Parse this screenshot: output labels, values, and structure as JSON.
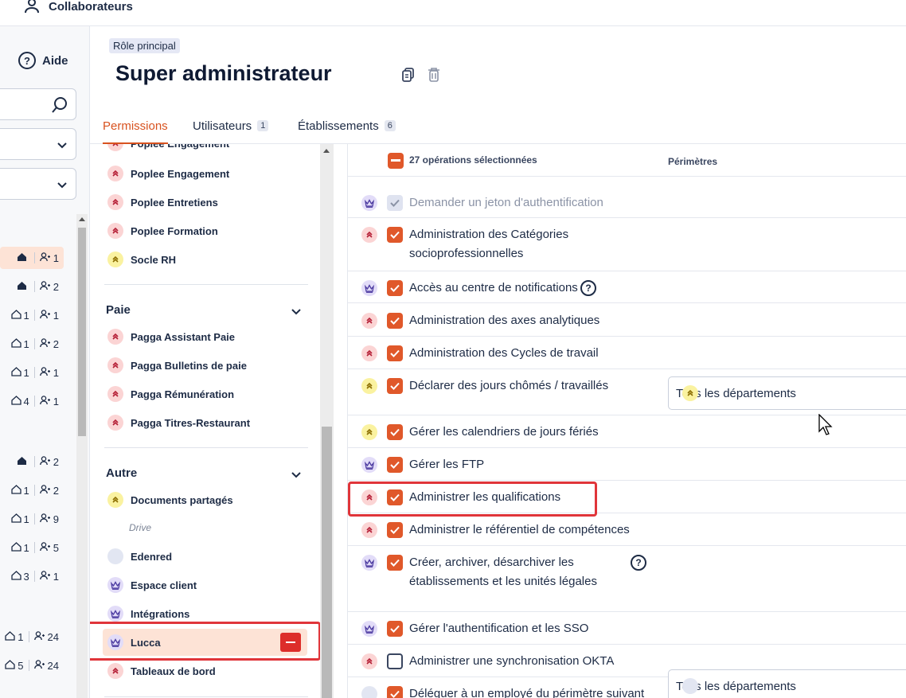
{
  "app": {
    "section_title": "Collaborateurs",
    "help_label": "Aide",
    "help_glyph": "?"
  },
  "left_sidebar": {
    "rows": [
      {
        "home": "",
        "count": "1",
        "highlight": true
      },
      {
        "home": "",
        "count": "2"
      },
      {
        "home": "1",
        "count": "1"
      },
      {
        "home": "1",
        "count": "2"
      },
      {
        "home": "1",
        "count": "1"
      },
      {
        "home": "4",
        "count": "1"
      },
      {
        "home": "",
        "count": "2"
      },
      {
        "home": "1",
        "count": "2"
      },
      {
        "home": "1",
        "count": "9"
      },
      {
        "home": "1",
        "count": "5"
      },
      {
        "home": "3",
        "count": "1"
      },
      {
        "home": "1",
        "count": "24"
      },
      {
        "home": "5",
        "count": "24"
      }
    ]
  },
  "header": {
    "badge": "Rôle principal",
    "title": "Super administrateur"
  },
  "tabs": [
    {
      "label": "Permissions",
      "count": "",
      "active": true
    },
    {
      "label": "Utilisateurs",
      "count": "1"
    },
    {
      "label": "Établissements",
      "count": "6"
    }
  ],
  "modules": {
    "top_items": [
      {
        "label": "Poplee Engagement",
        "color": "pink"
      },
      {
        "label": "Poplee Engagement",
        "color": "pink"
      },
      {
        "label": "Poplee Entretiens",
        "color": "pink"
      },
      {
        "label": "Poplee Formation",
        "color": "pink"
      },
      {
        "label": "Socle RH",
        "color": "yellow"
      }
    ],
    "paie": {
      "heading": "Paie",
      "items": [
        {
          "label": "Pagga Assistant Paie",
          "color": "pink"
        },
        {
          "label": "Pagga Bulletins de paie",
          "color": "pink"
        },
        {
          "label": "Pagga Rémunération",
          "color": "pink"
        },
        {
          "label": "Pagga Titres-Restaurant",
          "color": "pink"
        }
      ]
    },
    "autre": {
      "heading": "Autre",
      "items": [
        {
          "label": "Documents partagés",
          "color": "yellow"
        },
        {
          "label": "Edenred",
          "color": "grey"
        },
        {
          "label": "Espace client",
          "color": "purple"
        },
        {
          "label": "Intégrations",
          "color": "purple"
        },
        {
          "label": "Lucca",
          "color": "purple"
        },
        {
          "label": "Tableaux de bord",
          "color": "pink"
        }
      ],
      "sub_label": "Drive"
    }
  },
  "operations": {
    "selected_label": "27 opérations sélectionnées",
    "scope_header": "Périmètres",
    "rows": [
      {
        "text": "Demander un jeton d'authentification",
        "color": "purple",
        "state": "disabled"
      },
      {
        "text": "Administration des Catégories socioprofessionnelles",
        "color": "pink",
        "state": "on"
      },
      {
        "text": "Accès au centre de notifications",
        "color": "purple",
        "state": "on",
        "help": "?"
      },
      {
        "text": "Administration des axes analytiques",
        "color": "pink",
        "state": "on"
      },
      {
        "text": "Administration des Cycles de travail",
        "color": "pink",
        "state": "on"
      },
      {
        "text": "Déclarer des jours chômés / travaillés",
        "color": "yellow",
        "state": "on",
        "scope": "Tous les départements"
      },
      {
        "text": "Gérer les calendriers de jours fériés",
        "color": "yellow",
        "state": "on"
      },
      {
        "text": "Gérer les FTP",
        "color": "purple",
        "state": "on"
      },
      {
        "text": "Administrer les qualifications",
        "color": "pink",
        "state": "on"
      },
      {
        "text": "Administrer le référentiel de compétences",
        "color": "pink",
        "state": "on"
      },
      {
        "text": "Créer, archiver, désarchiver les établissements et les unités légales",
        "color": "purple",
        "state": "on",
        "help": "?"
      },
      {
        "text": "Gérer l'authentification et les SSO",
        "color": "purple",
        "state": "on"
      },
      {
        "text": "Administrer une synchronisation OKTA",
        "color": "pink",
        "state": "off"
      },
      {
        "text": "Déléguer à un employé du périmètre suivant",
        "color": "grey",
        "state": "on",
        "scope": "Tous les départements"
      }
    ]
  },
  "colors": {
    "accent": "#e0582a",
    "highlight_bg": "#fde3d6",
    "annotation": "#e0353a"
  }
}
